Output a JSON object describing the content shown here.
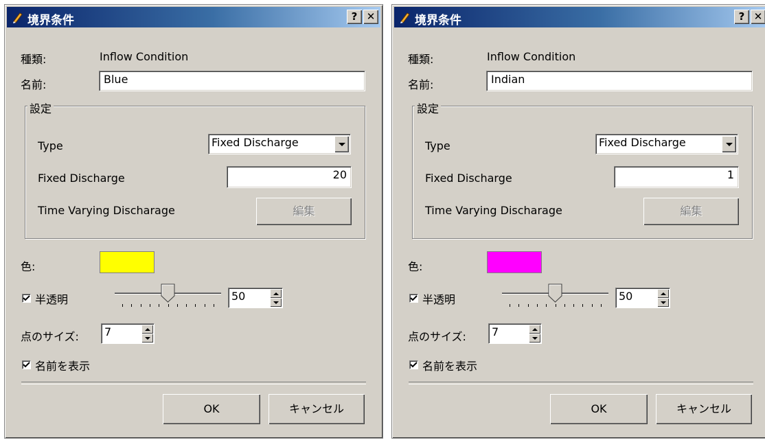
{
  "colors": {
    "title_gradient_start": "#0a246a",
    "title_gradient_end": "#a6caf0",
    "face": "#d4d0c8"
  },
  "dialogs": [
    {
      "title": "境界条件",
      "help_label": "?",
      "close_label": "✕",
      "kind_label": "種類:",
      "kind_value": "Inflow Condition",
      "name_label": "名前:",
      "name_value": "Blue",
      "settings_label": "設定",
      "type_label": "Type",
      "type_value": "Fixed Discharge",
      "fixed_discharge_label": "Fixed Discharge",
      "fixed_discharge_value": "20",
      "time_varying_label": "Time Varying Discharage",
      "edit_button": "編集",
      "color_label": "色:",
      "color_value": "#ffff00",
      "transparency_label": "半透明",
      "transparency_checked": true,
      "transparency_value": "50",
      "transparency_level": 50,
      "point_size_label": "点のサイズ:",
      "point_size_value": "7",
      "show_name_label": "名前を表示",
      "show_name_checked": true,
      "ok_button": "OK",
      "cancel_button": "キャンセル"
    },
    {
      "title": "境界条件",
      "help_label": "?",
      "close_label": "✕",
      "kind_label": "種類:",
      "kind_value": "Inflow Condition",
      "name_label": "名前:",
      "name_value": "Indian",
      "settings_label": "設定",
      "type_label": "Type",
      "type_value": "Fixed Discharge",
      "fixed_discharge_label": "Fixed Discharge",
      "fixed_discharge_value": "1",
      "time_varying_label": "Time Varying Discharage",
      "edit_button": "編集",
      "color_label": "色:",
      "color_value": "#ff00ff",
      "transparency_label": "半透明",
      "transparency_checked": true,
      "transparency_value": "50",
      "transparency_level": 50,
      "point_size_label": "点のサイズ:",
      "point_size_value": "7",
      "show_name_label": "名前を表示",
      "show_name_checked": true,
      "ok_button": "OK",
      "cancel_button": "キャンセル"
    }
  ]
}
